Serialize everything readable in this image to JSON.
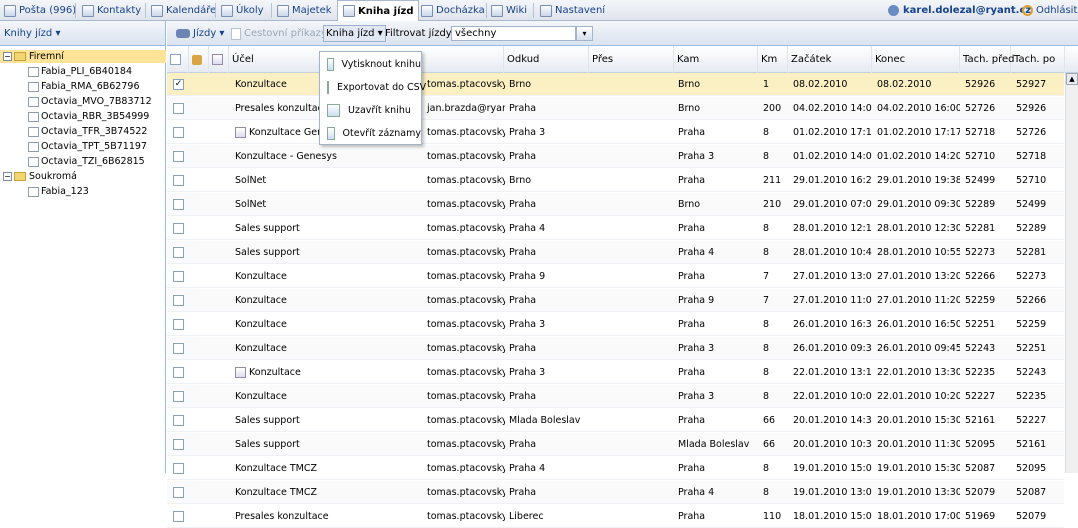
{
  "nav": {
    "tabs": [
      {
        "label": "Pošta (996)",
        "x": 0
      },
      {
        "label": "Kontakty",
        "x": 0
      },
      {
        "label": "Kalendáře",
        "x": 0
      },
      {
        "label": "Úkoly",
        "x": 0
      },
      {
        "label": "Majetek",
        "x": 0
      },
      {
        "label": "Kniha jízd",
        "x": 0
      },
      {
        "label": "Docházka",
        "x": 0
      },
      {
        "label": "Wiki",
        "x": 0
      },
      {
        "label": "Nastavení",
        "x": 0
      }
    ],
    "active_tab": "Kniha jízd",
    "user": "karel.dolezal@ryant.cz",
    "logout": "Odhlásit"
  },
  "sidebar": {
    "title": "Knihy jízd ▾",
    "groups": [
      {
        "label": "Firemní",
        "items": [
          "Fabia_PLI_6B40184",
          "Fabia_RMA_6B62796",
          "Octavia_MVO_7B83712",
          "Octavia_RBR_3B54999",
          "Octavia_TFR_3B74522",
          "Octavia_TPT_5B71197",
          "Octavia_TZI_6B62815"
        ]
      },
      {
        "label": "Soukromá",
        "items": [
          "Fabia_123"
        ]
      }
    ]
  },
  "toolbar": {
    "jizdy": "Jízdy ▾",
    "cestovni": "Cestovní příkazy ▾",
    "kniha": "Kniha jízd ▾",
    "filter_label": "Filtrovat jízdy:",
    "filter_value": "všechny"
  },
  "menu": {
    "items": [
      "Vytisknout knihu",
      "Exportovat do CSV",
      "Uzavřít knihu",
      "Otevřít záznamy"
    ]
  },
  "grid": {
    "columns": [
      "Účel",
      "Odkud",
      "Přes",
      "Kam",
      "Km",
      "Začátek",
      "Konec",
      "Tach. před",
      "Tach. po"
    ],
    "rows": [
      {
        "checked": "✓",
        "ucel": "Konzultace",
        "user": "tomas.ptacovsky@",
        "odkud": "Brno",
        "pres": "",
        "kam": "Brno",
        "km": "1",
        "zacatek": "08.02.2010",
        "konec": "08.02.2010",
        "tp": "52926",
        "tpo": "52927"
      },
      {
        "checked": "",
        "ucel": "Presales konzultace",
        "user": "jan.brazda@ryar",
        "odkud": "Praha",
        "pres": "",
        "kam": "Brno",
        "km": "200",
        "zacatek": "04.02.2010 14:00",
        "konec": "04.02.2010 16:00",
        "tp": "52726",
        "tpo": "52926"
      },
      {
        "checked": "",
        "ucel": "Konzultace Genesys",
        "user": "tomas.ptacovsky@",
        "odkud": "Praha 3",
        "pres": "",
        "kam": "Praha",
        "km": "8",
        "zacatek": "01.02.2010 17:10",
        "konec": "01.02.2010 17:17",
        "tp": "52718",
        "tpo": "52726"
      },
      {
        "checked": "",
        "ucel": "Konzultace - Genesys",
        "user": "tomas.ptacovsky@",
        "odkud": "Praha",
        "pres": "",
        "kam": "Praha 3",
        "km": "8",
        "zacatek": "01.02.2010 14:00",
        "konec": "01.02.2010 14:20",
        "tp": "52710",
        "tpo": "52718"
      },
      {
        "checked": "",
        "ucel": "SolNet",
        "user": "tomas.ptacovsky@",
        "odkud": "Brno",
        "pres": "",
        "kam": "Praha",
        "km": "211",
        "zacatek": "29.01.2010 16:23",
        "konec": "29.01.2010 19:38",
        "tp": "52499",
        "tpo": "52710"
      },
      {
        "checked": "",
        "ucel": "SolNet",
        "user": "tomas.ptacovsky@",
        "odkud": "Praha",
        "pres": "",
        "kam": "Brno",
        "km": "210",
        "zacatek": "29.01.2010 07:00",
        "konec": "29.01.2010 09:30",
        "tp": "52289",
        "tpo": "52499"
      },
      {
        "checked": "",
        "ucel": "Sales support",
        "user": "tomas.ptacovsky@",
        "odkud": "Praha 4",
        "pres": "",
        "kam": "Praha",
        "km": "8",
        "zacatek": "28.01.2010 12:10",
        "konec": "28.01.2010 12:30",
        "tp": "52281",
        "tpo": "52289"
      },
      {
        "checked": "",
        "ucel": "Sales support",
        "user": "tomas.ptacovsky@",
        "odkud": "Praha",
        "pres": "",
        "kam": "Praha 4",
        "km": "8",
        "zacatek": "28.01.2010 10:40",
        "konec": "28.01.2010 10:55",
        "tp": "52273",
        "tpo": "52281"
      },
      {
        "checked": "",
        "ucel": "Konzultace",
        "user": "tomas.ptacovsky@",
        "odkud": "Praha 9",
        "pres": "",
        "kam": "Praha",
        "km": "7",
        "zacatek": "27.01.2010 13:00",
        "konec": "27.01.2010 13:20",
        "tp": "52266",
        "tpo": "52273"
      },
      {
        "checked": "",
        "ucel": "Konzultace",
        "user": "tomas.ptacovsky@",
        "odkud": "Praha",
        "pres": "",
        "kam": "Praha 9",
        "km": "7",
        "zacatek": "27.01.2010 11:00",
        "konec": "27.01.2010 11:20",
        "tp": "52259",
        "tpo": "52266"
      },
      {
        "checked": "",
        "ucel": "Konzultace",
        "user": "tomas.ptacovsky@",
        "odkud": "Praha 3",
        "pres": "",
        "kam": "Praha",
        "km": "8",
        "zacatek": "26.01.2010 16:30",
        "konec": "26.01.2010 16:50",
        "tp": "52251",
        "tpo": "52259"
      },
      {
        "checked": "",
        "ucel": "Konzultace",
        "user": "tomas.ptacovsky@",
        "odkud": "Praha",
        "pres": "",
        "kam": "Praha 3",
        "km": "8",
        "zacatek": "26.01.2010 09:30",
        "konec": "26.01.2010 09:45",
        "tp": "52243",
        "tpo": "52251"
      },
      {
        "checked": "",
        "ucel": "Konzultace",
        "user": "tomas.ptacovsky@",
        "odkud": "Praha 3",
        "pres": "",
        "kam": "Praha",
        "km": "8",
        "zacatek": "22.01.2010 13:10",
        "konec": "22.01.2010 13:30",
        "tp": "52235",
        "tpo": "52243"
      },
      {
        "checked": "",
        "ucel": "Konzultace",
        "user": "tomas.ptacovsky@",
        "odkud": "Praha",
        "pres": "",
        "kam": "Praha 3",
        "km": "8",
        "zacatek": "22.01.2010 10:00",
        "konec": "22.01.2010 10:20",
        "tp": "52227",
        "tpo": "52235"
      },
      {
        "checked": "",
        "ucel": "Sales support",
        "user": "tomas.ptacovsky@",
        "odkud": "Mlada Boleslav",
        "pres": "",
        "kam": "Praha",
        "km": "66",
        "zacatek": "20.01.2010 14:30",
        "konec": "20.01.2010 15:30",
        "tp": "52161",
        "tpo": "52227"
      },
      {
        "checked": "",
        "ucel": "Sales support",
        "user": "tomas.ptacovsky@",
        "odkud": "Praha",
        "pres": "",
        "kam": "Mlada Boleslav",
        "km": "66",
        "zacatek": "20.01.2010 10:30",
        "konec": "20.01.2010 11:30",
        "tp": "52095",
        "tpo": "52161"
      },
      {
        "checked": "",
        "ucel": "Konzultace TMCZ",
        "user": "tomas.ptacovsky@",
        "odkud": "Praha 4",
        "pres": "",
        "kam": "Praha",
        "km": "8",
        "zacatek": "19.01.2010 15:00",
        "konec": "19.01.2010 15:30",
        "tp": "52087",
        "tpo": "52095"
      },
      {
        "checked": "",
        "ucel": "Konzultace TMCZ",
        "user": "tomas.ptacovsky@",
        "odkud": "Praha",
        "pres": "",
        "kam": "Praha 4",
        "km": "8",
        "zacatek": "19.01.2010 13:00",
        "konec": "19.01.2010 13:30",
        "tp": "52079",
        "tpo": "52087"
      },
      {
        "checked": "",
        "ucel": "Presales konzultace",
        "user": "tomas.ptacovsky@",
        "odkud": "Liberec",
        "pres": "",
        "kam": "Praha",
        "km": "110",
        "zacatek": "18.01.2010 15:00",
        "konec": "18.01.2010 17:00",
        "tp": "51969",
        "tpo": "52079"
      }
    ]
  }
}
